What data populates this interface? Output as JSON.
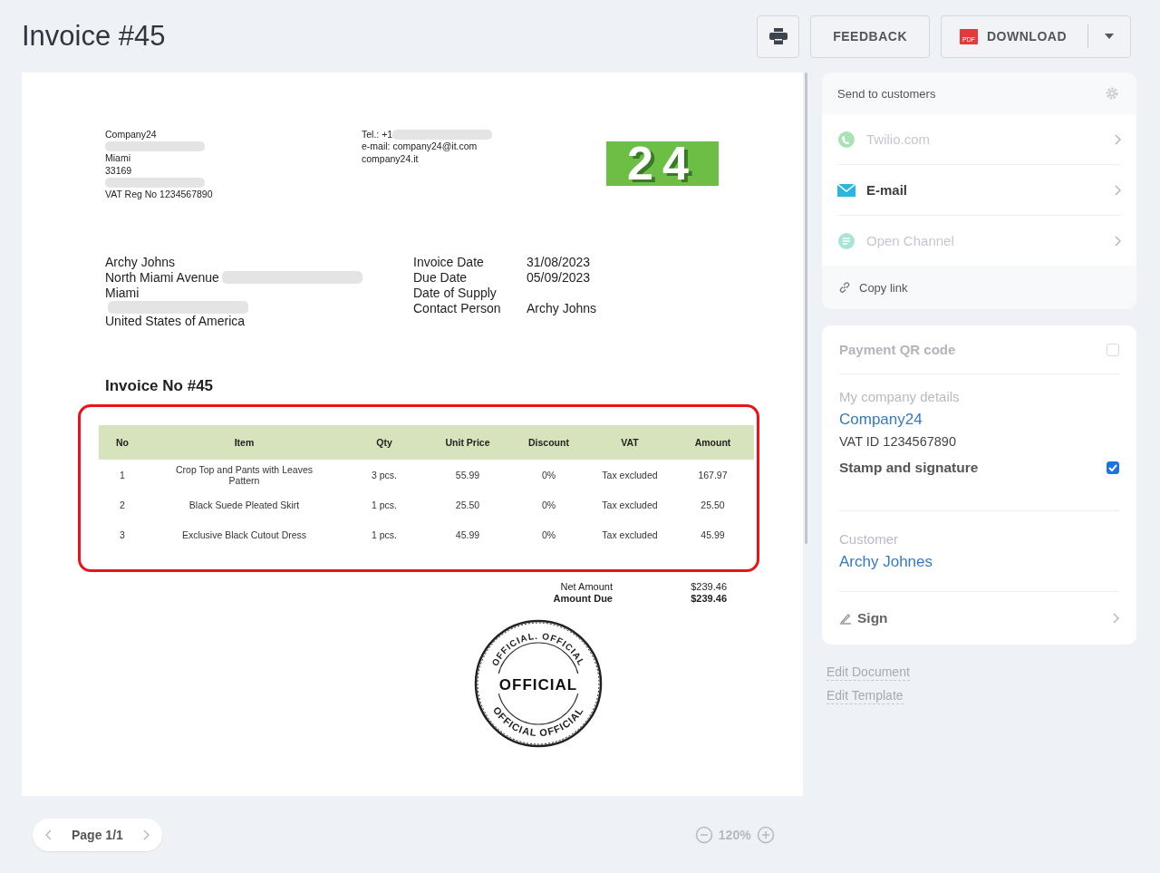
{
  "header": {
    "title": "Invoice #45",
    "feedback_button": "FEEDBACK",
    "download_button": {
      "icon_label": "PDF",
      "label": "DOWNLOAD"
    }
  },
  "document": {
    "seller_lines": [
      {
        "text": "Company24"
      },
      {
        "redacted": true
      },
      {
        "text": "Miami"
      },
      {
        "text": "33169"
      },
      {
        "redacted": true
      },
      {
        "text": "VAT Reg No 1234567890"
      }
    ],
    "contact_lines": [
      {
        "text": "Tel.: +1",
        "redacted": true
      },
      {
        "text": "e-mail: company24@it.com"
      },
      {
        "text": "company24.it"
      }
    ],
    "logo": "24",
    "customer_lines": [
      {
        "text": "Archy Johns"
      },
      {
        "text": "North Miami Avenue",
        "redacted": true
      },
      {
        "text": "Miami"
      },
      {
        "redacted": true
      },
      {
        "text": "United States of America"
      }
    ],
    "dates": [
      {
        "label": "Invoice Date",
        "value": "31/08/2023"
      },
      {
        "label": "Due Date",
        "value": "05/09/2023"
      },
      {
        "label": "Date of Supply"
      },
      {
        "label": "Contact Person",
        "value": "Archy Johns"
      }
    ],
    "invoice_heading": "Invoice No #45",
    "table": {
      "highlighted": true,
      "columns": [
        "No",
        "Item",
        "Qty",
        "Unit Price",
        "Discount",
        "VAT",
        "Amount"
      ],
      "rows": [
        [
          "1",
          "Crop Top and Pants with Leaves Pattern",
          "3 pcs.",
          "55.99",
          "0%",
          "Tax excluded",
          "167.97"
        ],
        [
          "2",
          "Black Suede Pleated Skirt",
          "1 pcs.",
          "25.50",
          "0%",
          "Tax excluded",
          "25.50"
        ],
        [
          "3",
          "Exclusive Black Cutout Dress",
          "1 pcs.",
          "45.99",
          "0%",
          "Tax excluded",
          "45.99"
        ]
      ]
    },
    "totals": [
      {
        "label": "Net Amount",
        "value": "$239.46",
        "bold": false
      },
      {
        "label": "Amount Due",
        "value": "$239.46",
        "bold": true
      }
    ],
    "stamp": {
      "ring_top": "OFFICIAL. OFFICIAL",
      "center": "OFFICIAL",
      "ring_bottom": "OFFICIAL OFFICIAL"
    }
  },
  "pager": {
    "label": "Page 1/1"
  },
  "zoom": {
    "label": "120%"
  },
  "sidebar": {
    "send": {
      "title": "Send to customers",
      "channels": [
        {
          "kind": "whatsapp",
          "label": "Twilio.com",
          "disabled": true
        },
        {
          "kind": "email",
          "label": "E-mail",
          "disabled": false
        },
        {
          "kind": "chat",
          "label": "Open Channel",
          "disabled": true
        }
      ],
      "copy_link": "Copy link"
    },
    "details": {
      "qr": {
        "label": "Payment QR code",
        "checked": false
      },
      "company_heading": "My company details",
      "company_name": "Company24",
      "vat": "VAT ID 1234567890",
      "stamp_option": {
        "label": "Stamp and signature",
        "checked": true
      },
      "customer_heading": "Customer",
      "customer_name": "Archy Johnes",
      "sign": "Sign"
    },
    "links": [
      "Edit Document",
      "Edit Template"
    ]
  }
}
